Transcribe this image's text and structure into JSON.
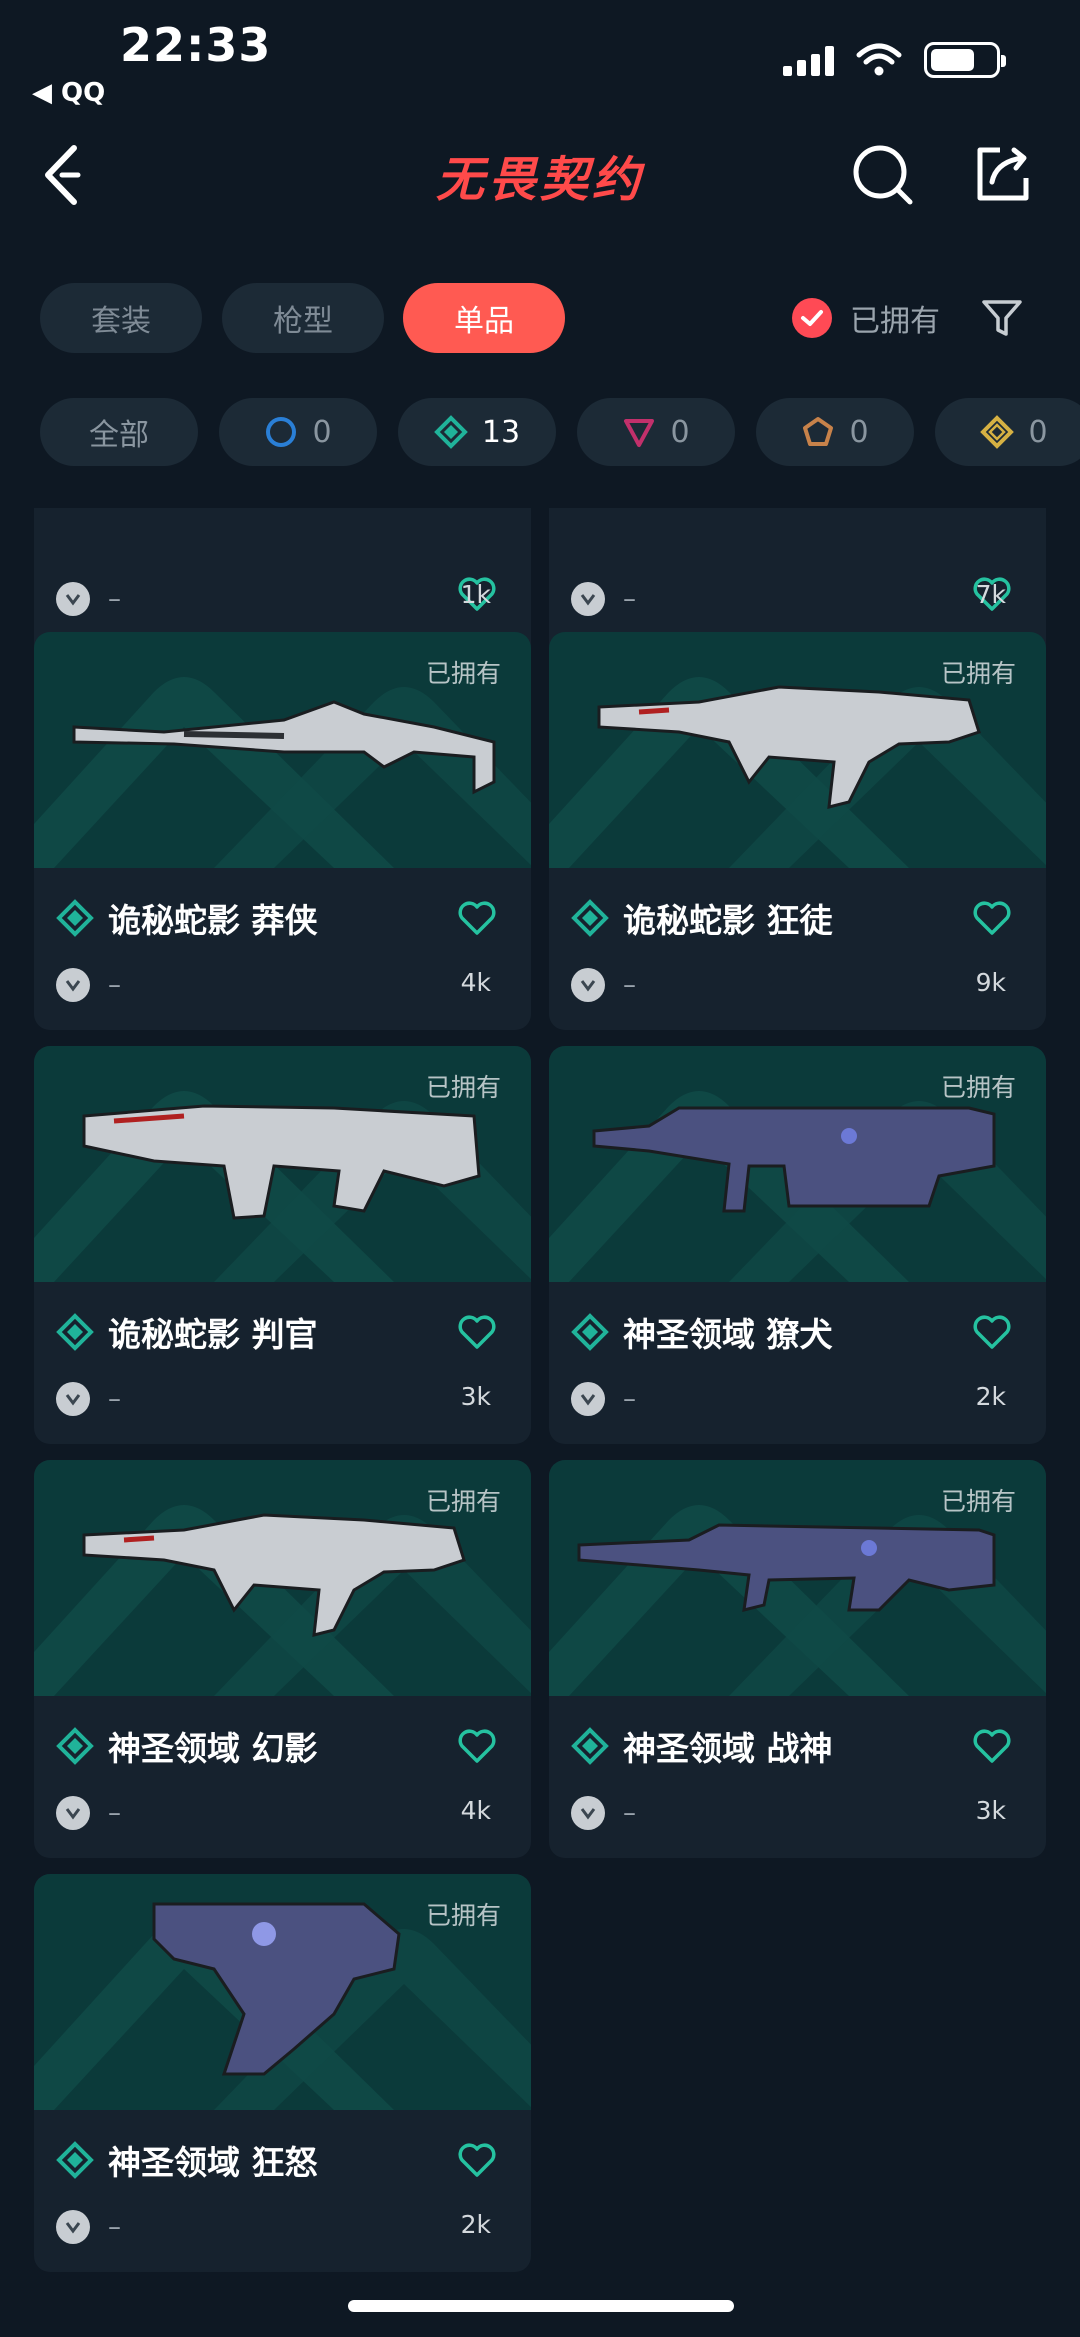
{
  "status": {
    "time": "22:33",
    "back_app": "◀ QQ"
  },
  "header": {
    "title": "无畏契约"
  },
  "tabs": [
    {
      "label": "套装",
      "active": false
    },
    {
      "label": "枪型",
      "active": false
    },
    {
      "label": "单品",
      "active": true
    }
  ],
  "owned_filter": {
    "label": "已拥有",
    "checked": true
  },
  "rarity_chips": [
    {
      "label": "全部",
      "icon": "all"
    },
    {
      "count": "0",
      "icon": "select-tier-icon",
      "color": "#2a7fd6"
    },
    {
      "count": "13",
      "icon": "deluxe-tier-icon",
      "color": "#20b39a",
      "active": true
    },
    {
      "count": "0",
      "icon": "premium-tier-icon",
      "color": "#c2306b"
    },
    {
      "count": "0",
      "icon": "exclusive-tier-icon",
      "color": "#c7824a"
    },
    {
      "count": "0",
      "icon": "ultra-tier-icon",
      "color": "#d6b143"
    }
  ],
  "partial_cards": [
    {
      "count": "1k"
    },
    {
      "count": "7k"
    }
  ],
  "cards": [
    {
      "owned": "已拥有",
      "name": "诡秘蛇影 莽侠",
      "sub": "–",
      "count": "4k",
      "weapon": "sniper-skin"
    },
    {
      "owned": "已拥有",
      "name": "诡秘蛇影 狂徒",
      "sub": "–",
      "count": "9k",
      "weapon": "rifle-skin"
    },
    {
      "owned": "已拥有",
      "name": "诡秘蛇影 判官",
      "sub": "–",
      "count": "3k",
      "weapon": "shotgun-skin"
    },
    {
      "owned": "已拥有",
      "name": "神圣领域 獠犬",
      "sub": "–",
      "count": "2k",
      "weapon": "smg-skin"
    },
    {
      "owned": "已拥有",
      "name": "神圣领域 幻影",
      "sub": "–",
      "count": "4k",
      "weapon": "rifle-skin"
    },
    {
      "owned": "已拥有",
      "name": "神圣领域 战神",
      "sub": "–",
      "count": "3k",
      "weapon": "lmg-skin"
    },
    {
      "owned": "已拥有",
      "name": "神圣领域 狂怒",
      "sub": "–",
      "count": "2k",
      "weapon": "pistol-skin"
    }
  ]
}
